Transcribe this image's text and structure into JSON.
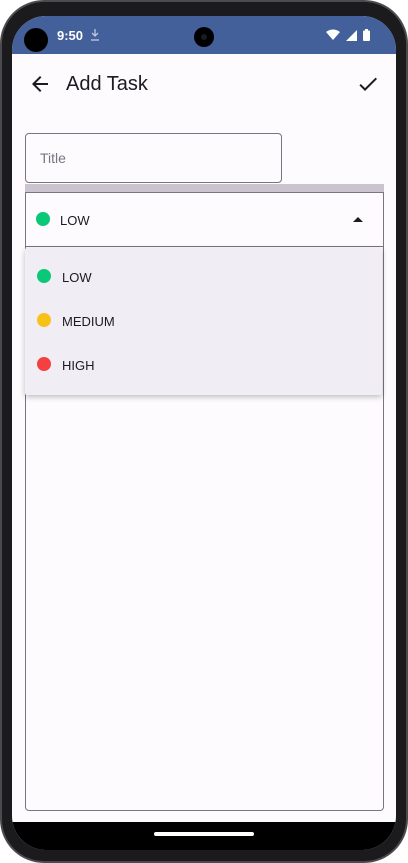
{
  "status_bar": {
    "time": "9:50",
    "icons": [
      "download-icon",
      "wifi-icon",
      "signal-icon",
      "battery-icon"
    ]
  },
  "app_bar": {
    "title": "Add Task",
    "back_icon": "arrow-back-icon",
    "confirm_icon": "check-icon"
  },
  "form": {
    "title_field": {
      "placeholder": "Title",
      "value": ""
    },
    "priority": {
      "selected_label": "LOW",
      "selected_color": "#0ac878",
      "options": [
        {
          "label": "LOW",
          "color": "#0ac878"
        },
        {
          "label": "MEDIUM",
          "color": "#f6c21a"
        },
        {
          "label": "HIGH",
          "color": "#f44040"
        }
      ]
    },
    "description_field": {
      "value": ""
    }
  },
  "colors": {
    "status_bar_bg": "#44609a",
    "surface": "#fdfbfe",
    "menu_bg": "#f0edf4",
    "outline": "#79747e"
  }
}
